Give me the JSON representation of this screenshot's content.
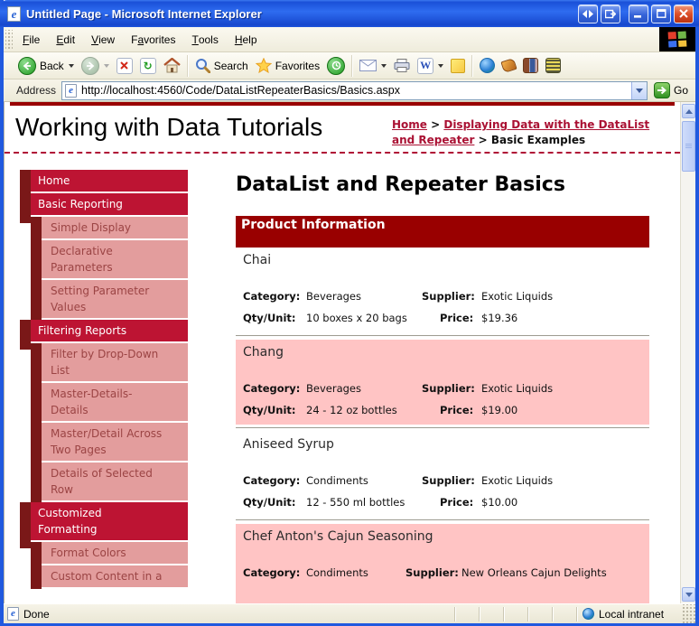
{
  "window": {
    "title": "Untitled Page - Microsoft Internet Explorer",
    "control_icons": [
      "left-right-arrows-icon",
      "popout-icon",
      "minimize-icon",
      "maximize-icon",
      "close-icon"
    ]
  },
  "menu_bar": {
    "items": [
      {
        "pre": "",
        "accel": "F",
        "post": "ile"
      },
      {
        "pre": "",
        "accel": "E",
        "post": "dit"
      },
      {
        "pre": "",
        "accel": "V",
        "post": "iew"
      },
      {
        "pre": "F",
        "accel": "a",
        "post": "vorites"
      },
      {
        "pre": "",
        "accel": "T",
        "post": "ools"
      },
      {
        "pre": "",
        "accel": "H",
        "post": "elp"
      }
    ],
    "logo_icon": "windows-flag-icon"
  },
  "toolbar": {
    "back_label": "Back",
    "search_label": "Search",
    "favorites_label": "Favorites",
    "icons": [
      "back-icon",
      "forward-icon",
      "stop-icon",
      "refresh-icon",
      "home-icon",
      "search-icon",
      "favorites-star-icon",
      "history-icon",
      "mail-icon",
      "print-icon",
      "edit-word-icon",
      "notes-icon",
      "messenger-globe-icon",
      "pen-icon",
      "research-icon",
      "grid-icon"
    ]
  },
  "address_bar": {
    "label": "Address",
    "url": "http://localhost:4560/Code/DataListRepeaterBasics/Basics.aspx",
    "go_label": "Go"
  },
  "page": {
    "title": "Working with Data Tutorials",
    "breadcrumb": {
      "home": "Home",
      "sep1": " > ",
      "section": "Displaying Data with the DataList and Repeater",
      "sep2": " > ",
      "current": "Basic Examples"
    },
    "sidebar": {
      "items": [
        {
          "label": "Home",
          "level": 1
        },
        {
          "label": "Basic Reporting",
          "level": 1
        },
        {
          "label": "Simple Display",
          "level": 2
        },
        {
          "label": "Declarative\nParameters",
          "level": 2
        },
        {
          "label": "Setting Parameter\nValues",
          "level": 2
        },
        {
          "label": "Filtering Reports",
          "level": 1
        },
        {
          "label": "Filter by Drop-Down\nList",
          "level": 2
        },
        {
          "label": "Master-Details-\nDetails",
          "level": 2
        },
        {
          "label": "Master/Detail Across\nTwo Pages",
          "level": 2
        },
        {
          "label": "Details of Selected\nRow",
          "level": 2
        },
        {
          "label": "Customized\nFormatting",
          "level": 1
        },
        {
          "label": "Format Colors",
          "level": 2
        },
        {
          "label": "Custom Content in a",
          "level": 2
        }
      ]
    },
    "main": {
      "heading": "DataList and Repeater Basics",
      "section_header": "Product Information",
      "field_labels": {
        "category": "Category:",
        "supplier": "Supplier:",
        "qty": "Qty/Unit:",
        "price": "Price:"
      },
      "products": [
        {
          "name": "Chai",
          "category": "Beverages",
          "supplier": "Exotic Liquids",
          "qty_per_unit": "10 boxes x 20 bags",
          "price": "$19.36"
        },
        {
          "name": "Chang",
          "category": "Beverages",
          "supplier": "Exotic Liquids",
          "qty_per_unit": "24 - 12 oz bottles",
          "price": "$19.00"
        },
        {
          "name": "Aniseed Syrup",
          "category": "Condiments",
          "supplier": "Exotic Liquids",
          "qty_per_unit": "12 - 550 ml bottles",
          "price": "$10.00"
        },
        {
          "name": "Chef Anton's Cajun Seasoning",
          "category": "Condiments",
          "supplier": "New Orleans Cajun Delights"
        }
      ]
    }
  },
  "status_bar": {
    "left": "Done",
    "zone": "Local intranet",
    "icons": [
      "ie-page-icon",
      "globe-icon"
    ]
  },
  "colors": {
    "titlebar_blue": "#1e53d6",
    "window_border_blue": "#2059df",
    "chrome_beige": "#f1eee1",
    "page_accent_red": "#990000",
    "link_red": "#aa1133",
    "nav_level1_bg": "#bd1433",
    "nav_indent_bg": "#7a1818",
    "nav_level2_bg": "#e39d9d",
    "nav_level2_text": "#9b4444",
    "alt_row_pink": "#ffc4c4"
  }
}
